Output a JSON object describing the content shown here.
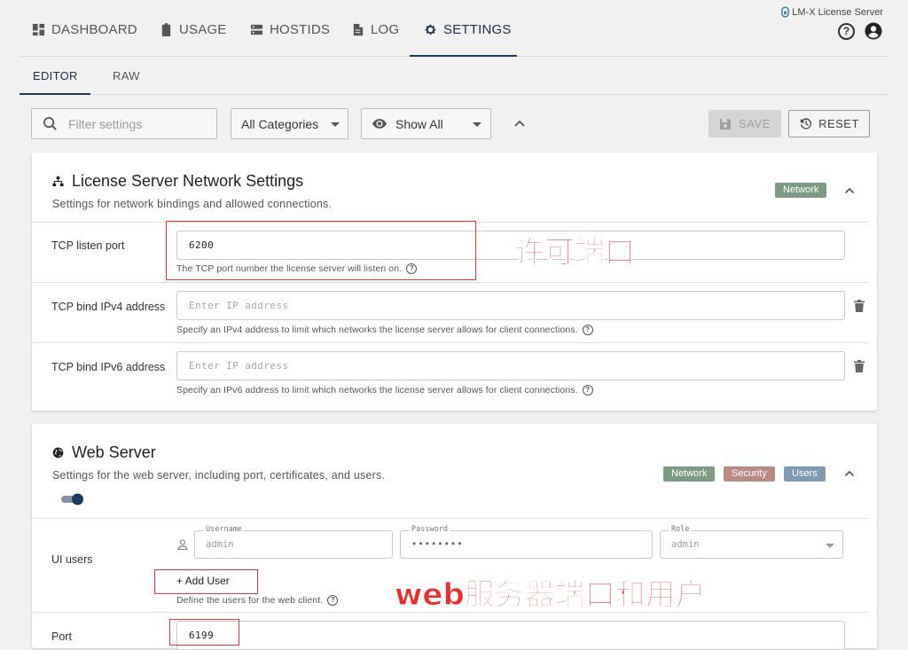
{
  "nav": {
    "tabs": [
      {
        "label": "DASHBOARD",
        "icon": "dashboard-icon"
      },
      {
        "label": "USAGE",
        "icon": "clipboard-icon"
      },
      {
        "label": "HOSTIDS",
        "icon": "server-icon"
      },
      {
        "label": "LOG",
        "icon": "document-icon"
      },
      {
        "label": "SETTINGS",
        "icon": "gear-icon",
        "active": true
      }
    ],
    "brand": "LM-X License Server",
    "help_symbol": "?"
  },
  "subtabs": [
    {
      "label": "EDITOR",
      "active": true
    },
    {
      "label": "RAW"
    }
  ],
  "toolbar": {
    "filter_placeholder": "Filter settings",
    "category_select": "All Categories",
    "show_select": "Show All",
    "save_label": "SAVE",
    "reset_label": "RESET"
  },
  "network_section": {
    "title": "License Server Network Settings",
    "description": "Settings for network bindings and allowed connections.",
    "tags": [
      {
        "label": "Network",
        "color": "#7d9a82"
      }
    ],
    "rows": [
      {
        "label": "TCP listen port",
        "value": "6200",
        "placeholder": "",
        "hint": "The TCP port number the license server will listen on."
      },
      {
        "label": "TCP bind IPv4 address",
        "value": "",
        "placeholder": "Enter IP address",
        "hint": "Specify an IPv4 address to limit which networks the license server allows for client connections."
      },
      {
        "label": "TCP bind IPv6 address",
        "value": "",
        "placeholder": "Enter IP address",
        "hint": "Specify an IPv6 address to limit which networks the license server allows for client connections."
      }
    ]
  },
  "web_section": {
    "title": "Web Server",
    "description": "Settings for the web server, including port, certificates, and users.",
    "tags": [
      {
        "label": "Network",
        "color": "#7d9a82"
      },
      {
        "label": "Security",
        "color": "#b98a86"
      },
      {
        "label": "Users",
        "color": "#7f9bb3"
      }
    ],
    "toggle_on": true,
    "ui_users": {
      "label": "UI users",
      "username_legend": "Username",
      "username_value": "admin",
      "password_legend": "Password",
      "password_value": "••••••••",
      "role_legend": "Role",
      "role_value": "admin",
      "add_user_label": "+ Add User",
      "hint": "Define the users for the web client."
    },
    "port": {
      "label": "Port",
      "value": "6199"
    }
  },
  "annotations": {
    "license_port_note": "许可端口",
    "web_port_users_note": "web服务器端口和用户"
  },
  "colors": {
    "accent": "#1d3a5c",
    "annotation_red": "#e53935"
  }
}
